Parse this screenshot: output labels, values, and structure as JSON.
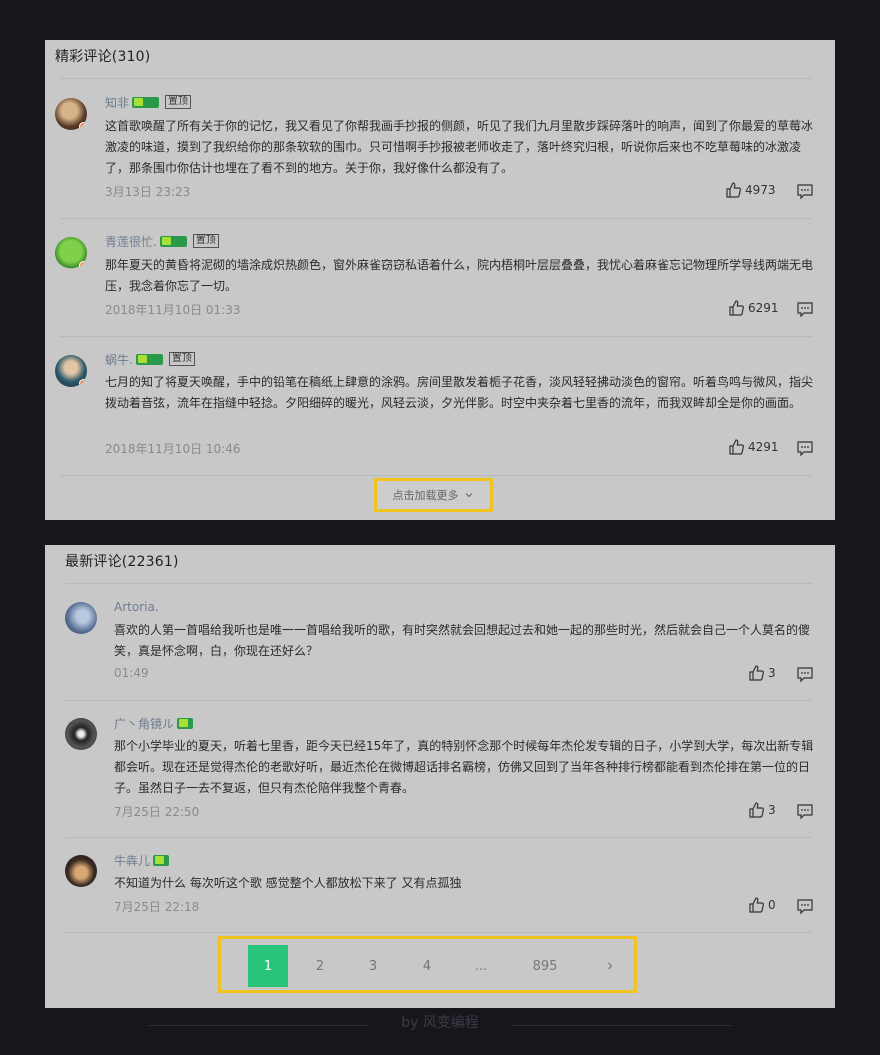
{
  "hot": {
    "title": "精彩评论(310)",
    "load_more": "点击加载更多",
    "comments": [
      {
        "user": "知非",
        "tag": "置顶",
        "text": "这首歌唤醒了所有关于你的记忆，我又看见了你帮我画手抄报的侧颜，听见了我们九月里散步踩碎落叶的响声，闻到了你最爱的草莓冰激凌的味道，摸到了我织给你的那条软软的围巾。只可惜啊手抄报被老师收走了，落叶终究归根，听说你后来也不吃草莓味的冰激凌了，那条围巾你估计也埋在了看不到的地方。关于你，我好像什么都没有了。",
        "time": "3月13日 23:23",
        "likes": "4973"
      },
      {
        "user": "青莲很忙.",
        "tag": "置顶",
        "text": "那年夏天的黄昏将泥砌的墙涂成炽热颜色，窗外麻雀窃窃私语着什么，院内梧桐叶层层叠叠，我忧心着麻雀忘记物理所学导线两端无电压，我念着你忘了一切。",
        "time": "2018年11月10日 01:33",
        "likes": "6291"
      },
      {
        "user": "蜗牛.",
        "tag": "置顶",
        "text": "七月的知了将夏天唤醒，手中的铅笔在稿纸上肆意的涂鸦。房间里散发着栀子花香，淡风轻轻拂动淡色的窗帘。听着鸟鸣与微风，指尖拨动着音弦，流年在指缝中轻捻。夕阳细碎的暖光，风轻云淡，夕光伴影。时空中夹杂着七里香的流年，而我双眸却全是你的画面。",
        "time": "2018年11月10日 10:46",
        "likes": "4291"
      }
    ]
  },
  "newest": {
    "title": "最新评论(22361)",
    "comments": [
      {
        "user": "Artoria.",
        "text": "喜欢的人第一首唱给我听也是唯一一首唱给我听的歌，有时突然就会回想起过去和她一起的那些时光，然后就会自己一个人莫名的傻笑，真是怀念啊，白，你现在还好么？",
        "time": "01:49",
        "likes": "3"
      },
      {
        "user": "广丶角镜ル",
        "text": "那个小学毕业的夏天，听着七里香，距今天已经15年了，真的特别怀念那个时候每年杰伦发专辑的日子，小学到大学，每次出新专辑都会听。现在还是觉得杰伦的老歌好听，最近杰伦在微博超话排名霸榜，仿佛又回到了当年各种排行榜都能看到杰伦排在第一位的日子。虽然日子一去不复返，但只有杰伦陪伴我整个青春。",
        "time": "7月25日 22:50",
        "likes": "3"
      },
      {
        "user": "牛犇儿",
        "text": "不知道为什么 每次听这个歌 感觉整个人都放松下来了 又有点孤独",
        "time": "7月25日 22:18",
        "likes": "0"
      }
    ]
  },
  "pagination": {
    "pages": [
      "1",
      "2",
      "3",
      "4",
      "...",
      "895"
    ],
    "active": "1",
    "next_icon": "chevron-right-icon"
  },
  "footer": "by 风变编程",
  "colors": {
    "accent": "#29c47a",
    "highlight": "#f0c420",
    "background": "#17161c"
  }
}
